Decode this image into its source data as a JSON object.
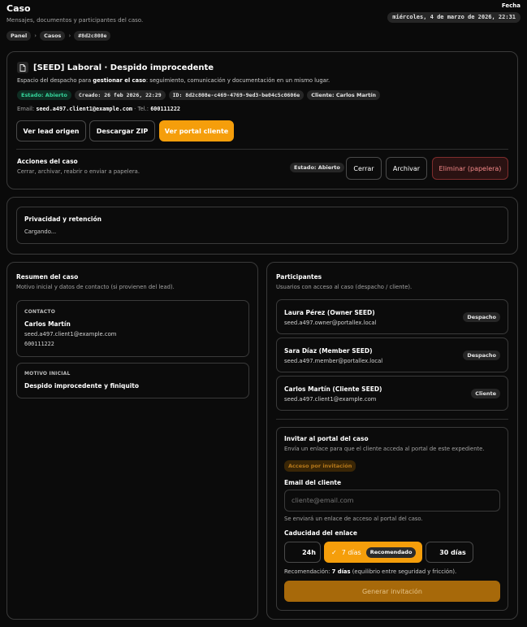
{
  "header": {
    "title": "Caso",
    "subtitle": "Mensajes, documentos y participantes del caso.",
    "date_label": "Fecha",
    "date_value": "miércoles, 4 de marzo de 2026, 22:31"
  },
  "breadcrumb": [
    "Panel",
    "Casos",
    "#8d2c808e"
  ],
  "case": {
    "icon": "document-icon",
    "title": "[SEED] Laboral · Despido improcedente",
    "description_pre": "Espacio del despacho para ",
    "description_bold": "gestionar el caso",
    "description_post": ": seguimiento, comunicación y documentación en un mismo lugar.",
    "badges": {
      "status": "Estado: Abierto",
      "created": "Creado: 26 feb 2026, 22:29",
      "id": "ID: 8d2c808e-c469-4769-9ed3-be04c5c0606e",
      "client": "Cliente: Carlos Martín"
    },
    "email_label": "Email:",
    "email_value": "seed.a497.client1@example.com",
    "phone_text": "· Tel.:",
    "phone_value": "600111222",
    "buttons": {
      "lead": "Ver lead origen",
      "zip": "Descargar ZIP",
      "portal": "Ver portal cliente"
    },
    "actions_title": "Acciones del caso",
    "actions_desc": "Cerrar, archivar, reabrir o enviar a papelera.",
    "actions_status": "Estado: Abierto",
    "close": "Cerrar",
    "archive": "Archivar",
    "delete": "Eliminar (papelera)"
  },
  "privacy": {
    "title": "Privacidad y retención",
    "loading": "Cargando..."
  },
  "summary": {
    "title": "Resumen del caso",
    "desc": "Motivo inicial y datos de contacto (si provienen del lead).",
    "contact_label": "CONTACTO",
    "contact_name": "Carlos Martín",
    "contact_email": "seed.a497.client1@example.com",
    "contact_phone": "600111222",
    "reason_label": "MOTIVO INICIAL",
    "reason_value": "Despido improcedente y finiquito"
  },
  "participants": {
    "title": "Participantes",
    "desc": "Usuarios con acceso al caso (despacho / cliente).",
    "items": [
      {
        "name": "Laura Pérez (Owner SEED)",
        "email": "seed.a497.owner@portallex.local",
        "role": "Despacho"
      },
      {
        "name": "Sara Díaz (Member SEED)",
        "email": "seed.a497.member@portallex.local",
        "role": "Despacho"
      },
      {
        "name": "Carlos Martín (Cliente SEED)",
        "email": "seed.a497.client1@example.com",
        "role": "Cliente"
      }
    ]
  },
  "invite": {
    "title": "Invitar al portal del caso",
    "desc": "Envía un enlace para que el cliente acceda al portal de este expediente.",
    "badge": "Acceso por invitación",
    "email_label": "Email del cliente",
    "email_placeholder": "cliente@email.com",
    "email_help": "Se enviará un enlace de acceso al portal del caso.",
    "expiry_label": "Caducidad del enlace",
    "option_24h": "24h",
    "option_7d": "7 días",
    "option_7d_badge": "Recomendado",
    "option_30d": "30 días",
    "selected_option": "7 días",
    "rec_pre": "Recomendación: ",
    "rec_bold": "7 días",
    "rec_post": " (equilibrio entre seguridad y fricción).",
    "submit": "Generar invitación"
  },
  "colors": {
    "accent": "#f59e0b",
    "success": "#34d399",
    "danger": "#f58a8a",
    "background": "#0a0a0a"
  }
}
